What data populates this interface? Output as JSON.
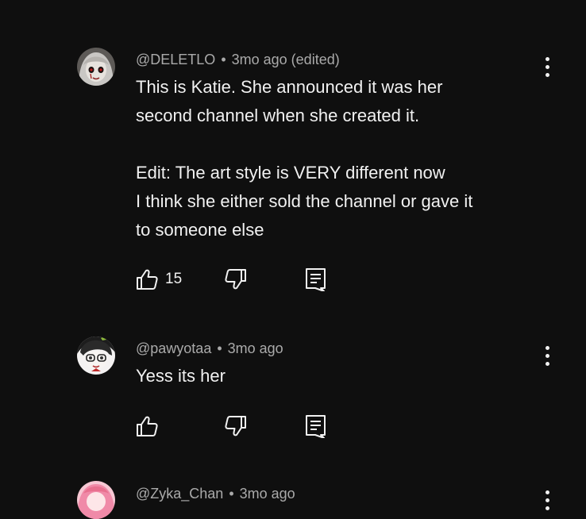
{
  "comments": [
    {
      "author": "@DELETLO",
      "time": "3mo ago (edited)",
      "text": "This is Katie. She announced it was her\nsecond channel when she created it.\n\nEdit: The art style is VERY different now\nI think she either sold the channel or gave it\nto someone else",
      "likes": "15",
      "avatar_icon": "avatar-gray-haired-character-icon"
    },
    {
      "author": "@pawyotaa",
      "time": "3mo ago",
      "text": "Yess its her",
      "likes": "",
      "avatar_icon": "avatar-dark-haired-character-icon"
    },
    {
      "author": "@Zyka_Chan",
      "time": "3mo ago",
      "text": "",
      "likes": "",
      "avatar_icon": "avatar-pink-haired-character-icon"
    }
  ],
  "separator": "•",
  "colors": {
    "background": "#0f0f0f",
    "text": "#f1f1f1",
    "meta": "#aaaaaa"
  }
}
